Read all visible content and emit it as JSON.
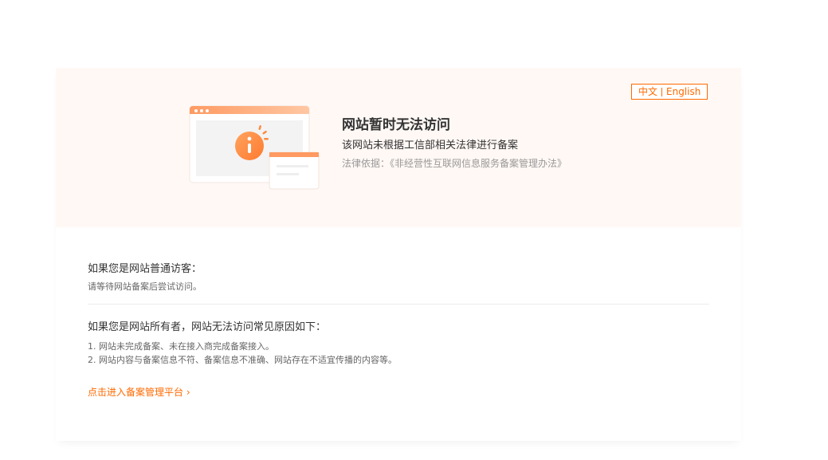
{
  "lang": {
    "zh": "中文",
    "en": "English"
  },
  "hero": {
    "title": "网站暂时无法访问",
    "description": "该网站未根据工信部相关法律进行备案",
    "legal_basis": "法律依据：《非经营性互联网信息服务备案管理办法》"
  },
  "visitor": {
    "heading": "如果您是网站普通访客：",
    "text": "请等待网站备案后尝试访问。"
  },
  "owner": {
    "heading": "如果您是网站所有者，网站无法访问常见原因如下：",
    "reasons": [
      "1. 网站未完成备案、未在接入商完成备案接入。",
      "2. 网站内容与备案信息不符、备案信息不准确、网站存在不适宜传播的内容等。"
    ],
    "link_label": "点击进入备案管理平台 ›"
  },
  "colors": {
    "accent": "#ff6a00",
    "banner_bg": "#fff8f5",
    "info_icon": "#ff8a3d"
  },
  "icons": {
    "illustration": "browser-window-info-illustration",
    "info": "info-icon"
  }
}
